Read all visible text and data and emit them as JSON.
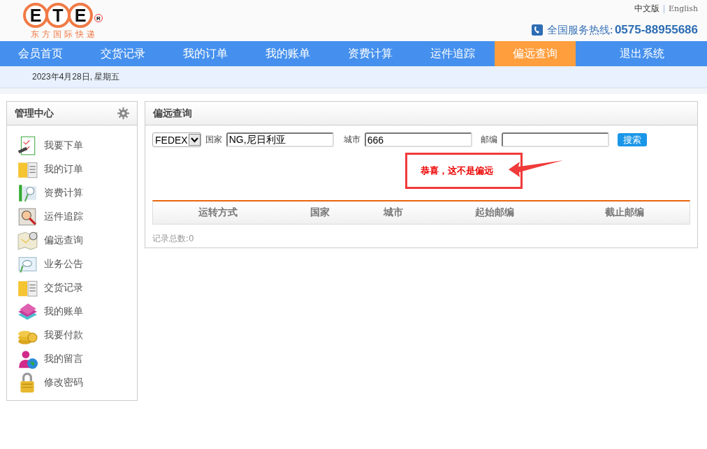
{
  "header": {
    "logo_letters": [
      "E",
      "T",
      "E"
    ],
    "logo_mark": "R",
    "logo_subtitle": "东方国际快递",
    "languages": [
      {
        "label": "中文版",
        "selected": true
      },
      {
        "label": "English",
        "selected": false
      }
    ],
    "hotline_label": "全国服务热线:",
    "hotline_number": "0575-88955686"
  },
  "nav": [
    {
      "label": "会员首页",
      "selected": false
    },
    {
      "label": "交货记录",
      "selected": false
    },
    {
      "label": "我的订单",
      "selected": false
    },
    {
      "label": "我的账单",
      "selected": false
    },
    {
      "label": "资费计算",
      "selected": false
    },
    {
      "label": "运件追踪",
      "selected": false
    },
    {
      "label": "偏远查询",
      "selected": true
    },
    {
      "label": "退出系统",
      "selected": false
    }
  ],
  "date": "2023年4月28日, 星期五",
  "sidebar": {
    "title": "管理中心",
    "items": [
      "我要下单",
      "我的订单",
      "资费计算",
      "运件追踪",
      "偏远查询",
      "业务公告",
      "交货记录",
      "我的账单",
      "我要付款",
      "我的留言",
      "修改密码"
    ]
  },
  "panel": {
    "title": "偏远查询",
    "carrier": "FEDEX",
    "fields": [
      {
        "label": "国家",
        "value": "NG,尼日利亚"
      },
      {
        "label": "城市",
        "value": "666"
      },
      {
        "label": "邮编"
      }
    ],
    "search_button": "搜索",
    "message": "恭喜，这不是偏远",
    "table": {
      "columns": [
        "运转方式",
        "国家",
        "城市",
        "起始邮编",
        "截止邮编"
      ]
    },
    "record_count": "记录总数:0"
  }
}
